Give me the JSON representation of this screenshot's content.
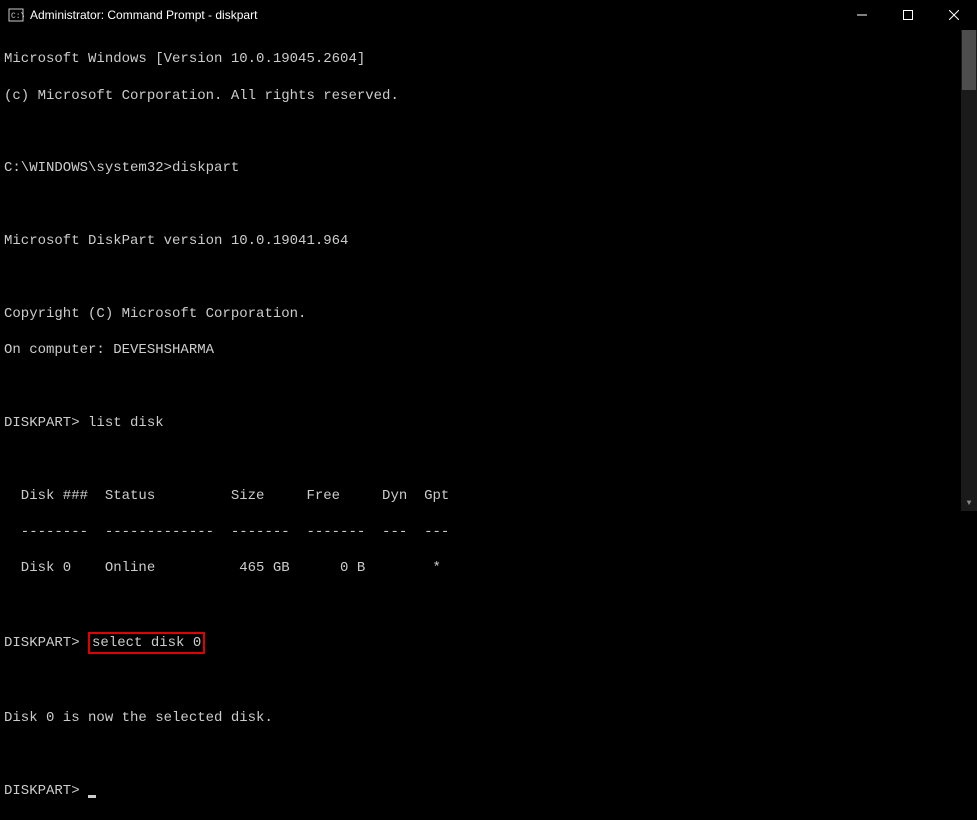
{
  "titlebar": {
    "title": "Administrator: Command Prompt - diskpart"
  },
  "terminal": {
    "line1": "Microsoft Windows [Version 10.0.19045.2604]",
    "line2": "(c) Microsoft Corporation. All rights reserved.",
    "blank1": "",
    "line3a": "C:\\WINDOWS\\system32>",
    "line3b": "diskpart",
    "blank2": "",
    "line4": "Microsoft DiskPart version 10.0.19041.964",
    "blank3": "",
    "line5": "Copyright (C) Microsoft Corporation.",
    "line6": "On computer: DEVESHSHARMA",
    "blank4": "",
    "line7a": "DISKPART> ",
    "line7b": "list disk",
    "blank5": "",
    "tableHeader": "  Disk ###  Status         Size     Free     Dyn  Gpt",
    "tableSep": "  --------  -------------  -------  -------  ---  ---",
    "tableRow": "  Disk 0    Online          465 GB      0 B        *",
    "blank6": "",
    "line8a": "DISKPART> ",
    "line8b": "select disk 0",
    "blank7": "",
    "line9": "Disk 0 is now the selected disk.",
    "blank8": "",
    "line10a": "DISKPART> "
  }
}
